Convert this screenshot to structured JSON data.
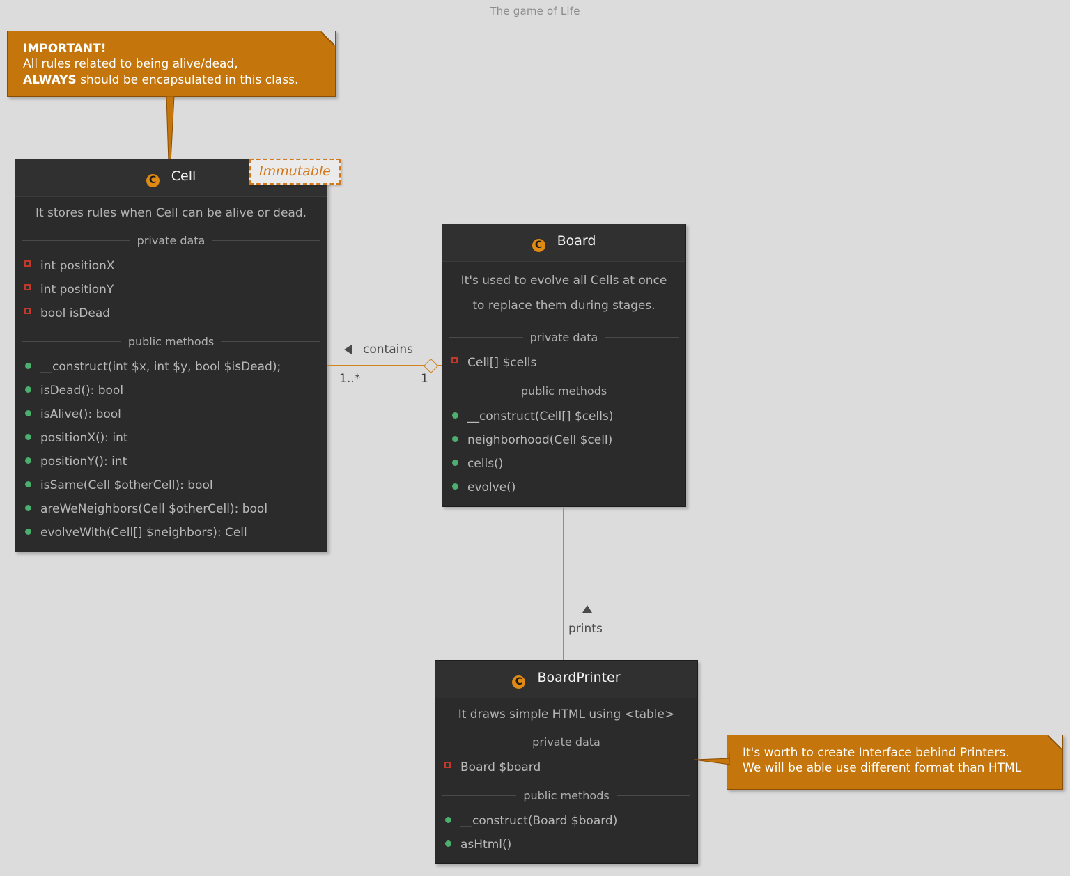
{
  "diagram": {
    "title": "The game of Life"
  },
  "notes": [
    {
      "id": "note-cell",
      "line1_bold": "IMPORTANT!",
      "line2": "All rules related to being alive/dead,",
      "line3_bold": "ALWAYS",
      "line3_rest": " should be encapsulated in this class."
    },
    {
      "id": "note-printer",
      "line1": "It's worth to create Interface behind Printers.",
      "line2": "We will be able use different format than HTML"
    }
  ],
  "classes": {
    "cell": {
      "icon": "class-icon-C",
      "name": "Cell",
      "stereotype": "Immutable",
      "description": "It stores rules when Cell can be alive or dead.",
      "private_label": "private data",
      "private_data": [
        "int positionX",
        "int positionY",
        "bool isDead"
      ],
      "methods_label": "public methods",
      "public_methods": [
        "__construct(int $x, int $y, bool $isDead);",
        "isDead(): bool",
        "isAlive(): bool",
        "positionX(): int",
        "positionY(): int",
        "isSame(Cell $otherCell): bool",
        "areWeNeighbors(Cell $otherCell): bool",
        "evolveWith(Cell[] $neighbors): Cell"
      ]
    },
    "board": {
      "icon": "class-icon-C",
      "name": "Board",
      "description_line1": "It's used to evolve all Cells at once",
      "description_line2": "to replace them during stages.",
      "private_label": "private data",
      "private_data": [
        "Cell[] $cells"
      ],
      "methods_label": "public methods",
      "public_methods": [
        "__construct(Cell[] $cells)",
        "neighborhood(Cell $cell)",
        "cells()",
        "evolve()"
      ]
    },
    "board_printer": {
      "icon": "class-icon-C",
      "name": "BoardPrinter",
      "description": "It draws simple HTML using <table>",
      "private_label": "private data",
      "private_data": [
        "Board $board"
      ],
      "methods_label": "public methods",
      "public_methods": [
        "__construct(Board $board)",
        "asHtml()"
      ]
    }
  },
  "relations": {
    "contains": {
      "label": "contains",
      "arrow": "triangle-left-icon",
      "source_multiplicity": "1..*",
      "target_multiplicity": "1"
    },
    "prints": {
      "label": "prints",
      "arrow": "triangle-up-icon"
    }
  },
  "colors": {
    "accent": "#d2821c",
    "note_bg": "#c4750b",
    "class_bg": "#2b2b2b",
    "header_bg": "#303030",
    "private_marker": "#c0392b",
    "public_marker": "#4caf6d",
    "canvas_bg": "#dcdcdc"
  }
}
